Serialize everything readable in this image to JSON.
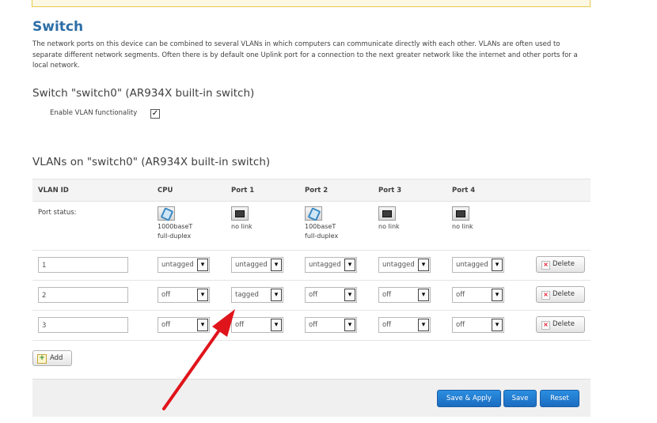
{
  "page": {
    "title": "Switch",
    "intro": "The network ports on this device can be combined to several VLANs in which computers can communicate directly with each other. VLANs are often used to separate different network segments. Often there is by default one Uplink port for a connection to the next greater network like the internet and other ports for a local network."
  },
  "switch": {
    "heading": "Switch \"switch0\" (AR934X built-in switch)",
    "enable_vlan_label": "Enable VLAN functionality",
    "enable_vlan_checked": true
  },
  "vlans": {
    "heading": "VLANs on \"switch0\" (AR934X built-in switch)",
    "columns": [
      "VLAN ID",
      "CPU",
      "Port 1",
      "Port 2",
      "Port 3",
      "Port 4"
    ],
    "port_status_label": "Port status:",
    "port_status": [
      {
        "icon": "ethernet-up-icon",
        "line1": "1000baseT",
        "line2": "full-duplex"
      },
      {
        "icon": "ethernet-down-icon",
        "line1": "no link",
        "line2": ""
      },
      {
        "icon": "ethernet-up-icon",
        "line1": "100baseT",
        "line2": "full-duplex"
      },
      {
        "icon": "ethernet-down-icon",
        "line1": "no link",
        "line2": ""
      },
      {
        "icon": "ethernet-down-icon",
        "line1": "no link",
        "line2": ""
      }
    ],
    "rows": [
      {
        "id": "1",
        "ports": [
          "untagged",
          "untagged",
          "untagged",
          "untagged",
          "untagged"
        ]
      },
      {
        "id": "2",
        "ports": [
          "off",
          "tagged",
          "off",
          "off",
          "off"
        ]
      },
      {
        "id": "3",
        "ports": [
          "off",
          "off",
          "off",
          "off",
          "off"
        ]
      }
    ],
    "delete_label": "Delete",
    "add_label": "Add"
  },
  "footer": {
    "save_apply": "Save & Apply",
    "save": "Save",
    "reset": "Reset"
  },
  "colors": {
    "accent": "#1b6cc0",
    "title": "#2d6ea6",
    "annotation_arrow": "#e0141b"
  }
}
